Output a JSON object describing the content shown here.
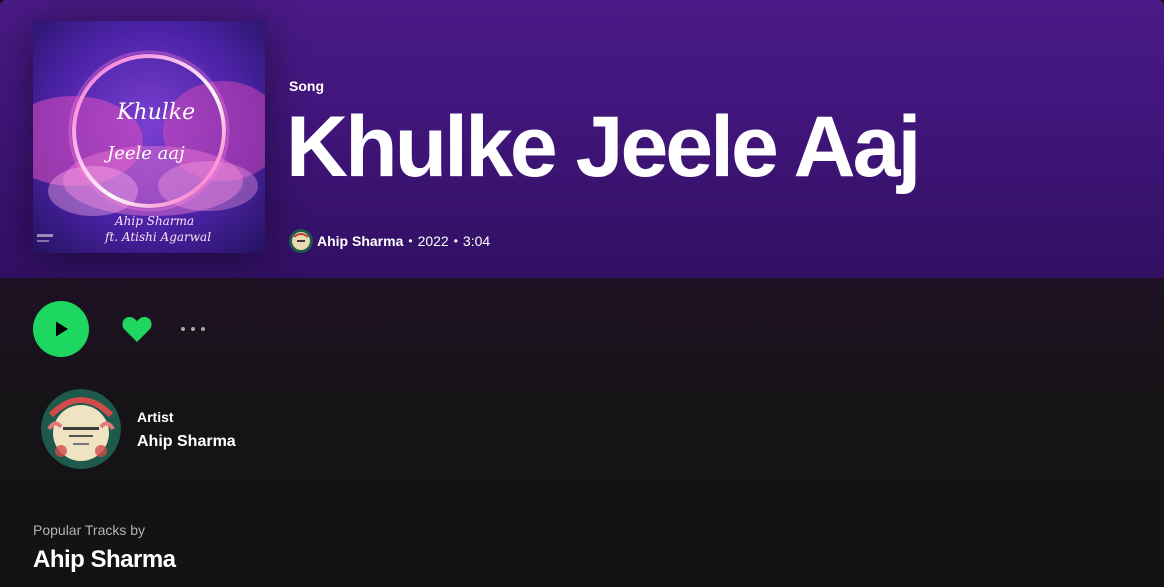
{
  "track": {
    "type_label": "Song",
    "title": "Khulke Jeele Aaj",
    "artist": "Ahip Sharma",
    "year": "2022",
    "duration": "3:04",
    "separator": "•"
  },
  "cover": {
    "title_line1": "Khulke",
    "title_line2": "Jeele aaj",
    "credit_line1": "Ahip Sharma",
    "credit_line2": "ft. Atishi Agarwal"
  },
  "actions": {
    "play": "play-icon",
    "like": "heart-icon",
    "more": "more-icon"
  },
  "artist_section": {
    "label": "Artist",
    "name": "Ahip Sharma"
  },
  "popular": {
    "label": "Popular Tracks by",
    "artist": "Ahip Sharma"
  },
  "colors": {
    "accent": "#1ed760",
    "header_top": "#4a1a86",
    "background": "#131213"
  }
}
